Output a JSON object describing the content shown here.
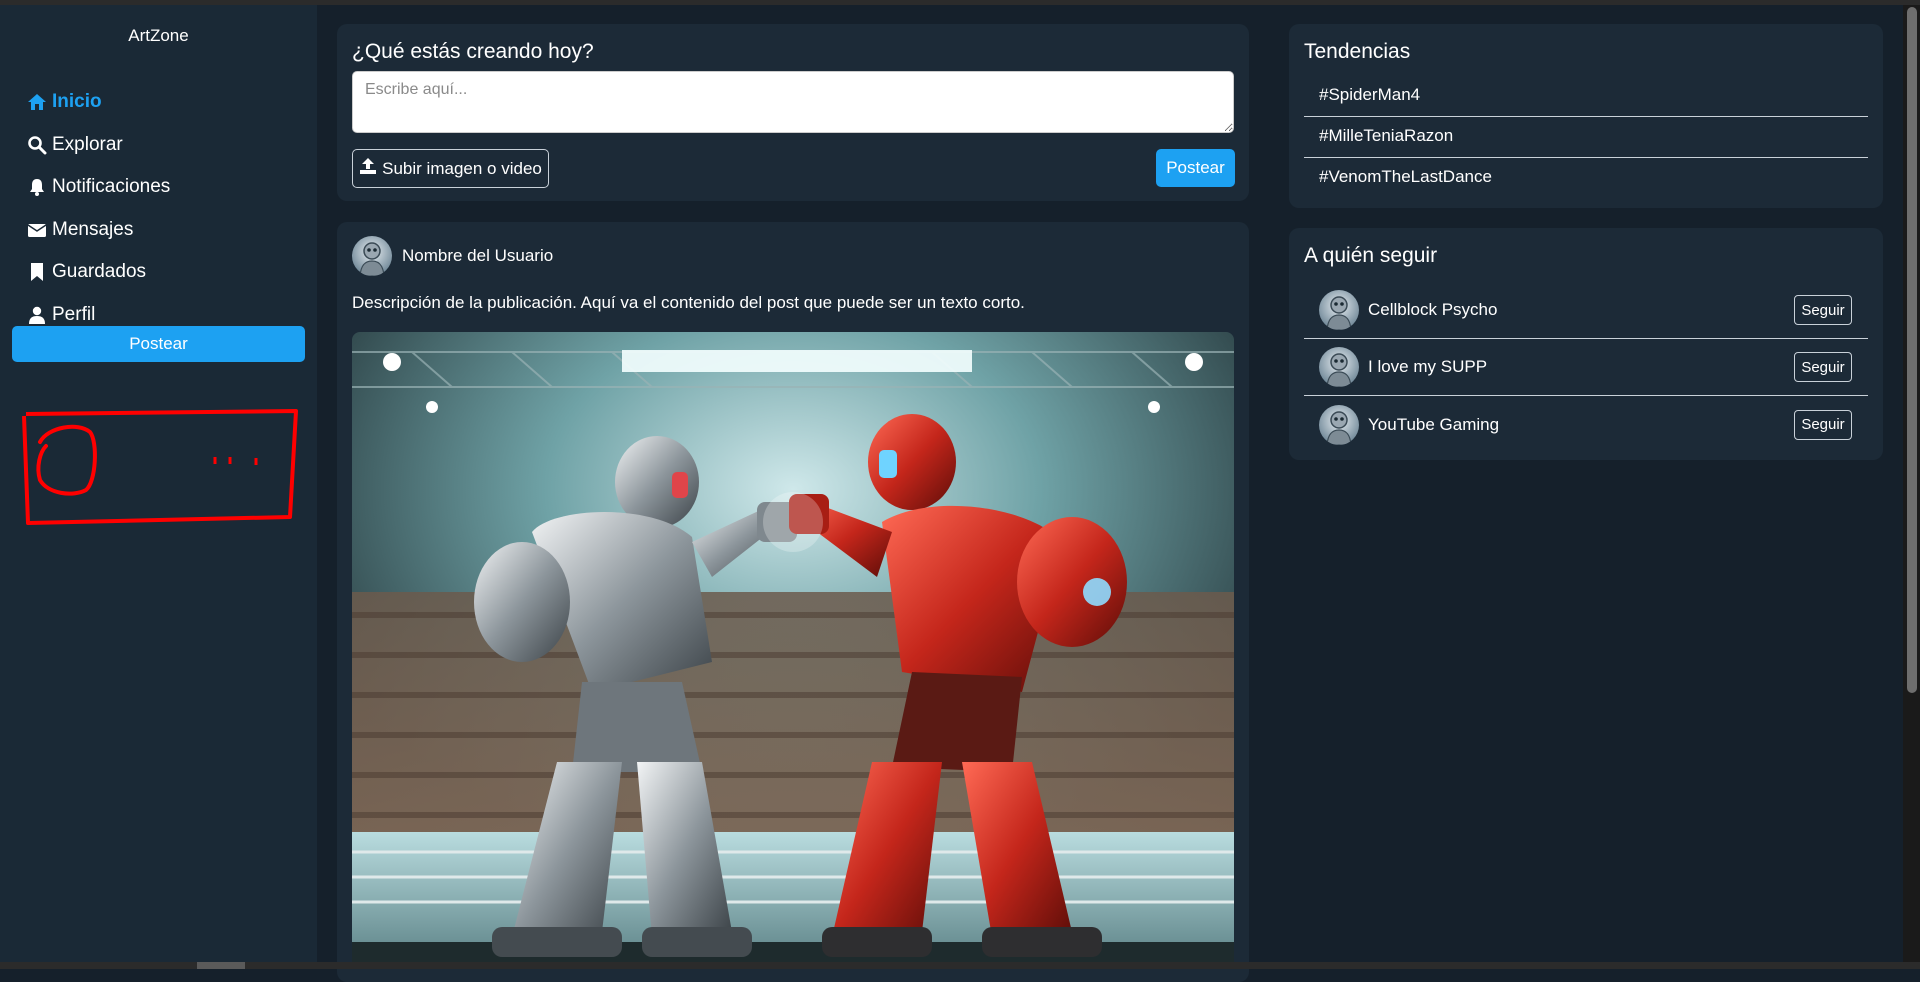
{
  "app": {
    "brand": "ArtZone"
  },
  "sidebar": {
    "items": [
      {
        "label": "Inicio",
        "icon": "home-icon",
        "active": true
      },
      {
        "label": "Explorar",
        "icon": "search-icon"
      },
      {
        "label": "Notificaciones",
        "icon": "bell-icon"
      },
      {
        "label": "Mensajes",
        "icon": "envelope-icon"
      },
      {
        "label": "Guardados",
        "icon": "bookmark-icon"
      },
      {
        "label": "Perfil",
        "icon": "user-icon"
      }
    ],
    "post_button": "Postear"
  },
  "composer": {
    "title": "¿Qué estás creando hoy?",
    "placeholder": "Escribe aquí...",
    "upload_label": "Subir imagen o video",
    "post_label": "Postear"
  },
  "post": {
    "username": "Nombre del Usuario",
    "description": "Descripción de la publicación. Aquí va el contenido del post que puede ser un texto corto."
  },
  "trends": {
    "title": "Tendencias",
    "items": [
      "#SpiderMan4",
      "#MilleTeniaRazon",
      "#VenomTheLastDance"
    ]
  },
  "follow": {
    "title": "A quién seguir",
    "items": [
      {
        "name": "Cellblock Psycho",
        "button": "Seguir"
      },
      {
        "name": "I love my SUPP",
        "button": "Seguir"
      },
      {
        "name": "YouTube Gaming",
        "button": "Seguir"
      }
    ]
  },
  "colors": {
    "accent": "#1da1f2",
    "background": "#15202b",
    "card": "#1c2a37",
    "sidebar": "#1a2936"
  }
}
